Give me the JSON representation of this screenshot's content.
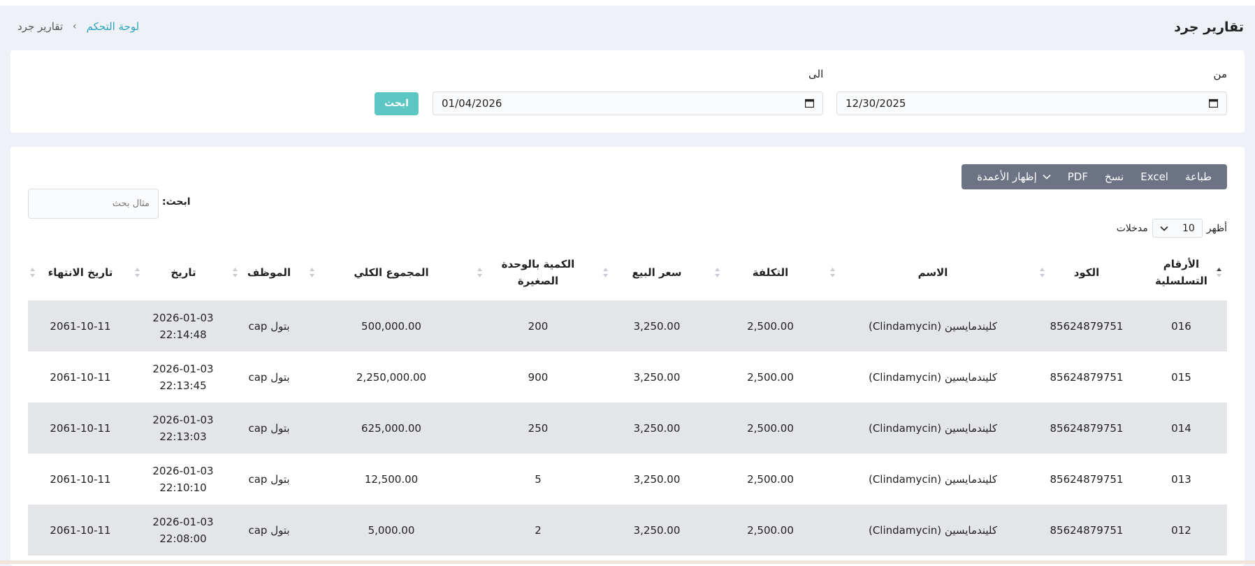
{
  "page": {
    "title": "تقارير جرد"
  },
  "breadcrumb": {
    "home": "لوحة التحكم",
    "separator": "›",
    "current": "تقارير جرد"
  },
  "filter": {
    "from_label": "من",
    "from_value": "12/30/2025",
    "to_label": "الى",
    "to_value": "01/04/2026",
    "search_button": "ابحث"
  },
  "toolbar": {
    "print": "طباعة",
    "excel": "Excel",
    "copy": "نسخ",
    "pdf": "PDF",
    "columns": "إظهار الأعمدة"
  },
  "table_search": {
    "label": "ابحث:",
    "placeholder": "مثال بحث"
  },
  "length_menu": {
    "show": "أظهر",
    "value": "10",
    "entries": "مدخلات"
  },
  "table": {
    "headers": {
      "serial": "الأرقام التسلسلية",
      "code": "الكود",
      "name": "الاسم",
      "cost": "التكلفة",
      "price": "سعر البيع",
      "qty": "الكمية بالوحدة الصغيرة",
      "total": "المجموع الكلي",
      "employee": "الموظف",
      "date": "تاريخ",
      "expiry": "تاريخ الانتهاء"
    },
    "rows": [
      {
        "serial": "016",
        "code": "85624879751",
        "name": "كليندمايسين (Clindamycin)",
        "cost": "2,500.00",
        "price": "3,250.00",
        "qty": "200",
        "total": "500,000.00",
        "employee": "بتول cap",
        "date": "2026-01-03 22:14:48",
        "expiry": "2061-10-11"
      },
      {
        "serial": "015",
        "code": "85624879751",
        "name": "كليندمايسين (Clindamycin)",
        "cost": "2,500.00",
        "price": "3,250.00",
        "qty": "900",
        "total": "2,250,000.00",
        "employee": "بتول cap",
        "date": "2026-01-03 22:13:45",
        "expiry": "2061-10-11"
      },
      {
        "serial": "014",
        "code": "85624879751",
        "name": "كليندمايسين (Clindamycin)",
        "cost": "2,500.00",
        "price": "3,250.00",
        "qty": "250",
        "total": "625,000.00",
        "employee": "بتول cap",
        "date": "2026-01-03 22:13:03",
        "expiry": "2061-10-11"
      },
      {
        "serial": "013",
        "code": "85624879751",
        "name": "كليندمايسين (Clindamycin)",
        "cost": "2,500.00",
        "price": "3,250.00",
        "qty": "5",
        "total": "12,500.00",
        "employee": "بتول cap",
        "date": "2026-01-03 22:10:10",
        "expiry": "2061-10-11"
      },
      {
        "serial": "012",
        "code": "85624879751",
        "name": "كليندمايسين (Clindamycin)",
        "cost": "2,500.00",
        "price": "3,250.00",
        "qty": "2",
        "total": "5,000.00",
        "employee": "بتول cap",
        "date": "2026-01-03 22:08:00",
        "expiry": "2061-10-11"
      }
    ]
  }
}
